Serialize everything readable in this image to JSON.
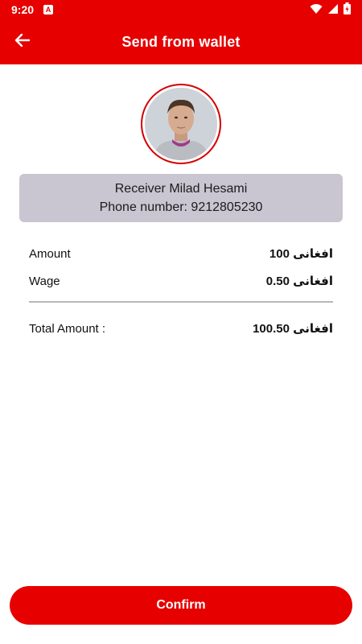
{
  "status_bar": {
    "time": "9:20",
    "notification_icon": "app-notification-icon",
    "wifi_icon": "wifi-icon",
    "signal_icon": "cell-signal-icon",
    "battery_icon": "battery-icon"
  },
  "app_bar": {
    "title": "Send from wallet",
    "back_icon": "arrow-left-icon"
  },
  "receiver": {
    "name_line": "Receiver Milad Hesami",
    "phone_line": "Phone number: 9212805230"
  },
  "details": {
    "amount_label": "Amount",
    "amount_value": "افغانی 100",
    "wage_label": "Wage",
    "wage_value": "افغانی 0.50",
    "total_label": "Total Amount :",
    "total_value": "افغانی 100.50"
  },
  "confirm_label": "Confirm",
  "colors": {
    "brand": "#e60000",
    "card_bg": "#c9c6d1"
  }
}
